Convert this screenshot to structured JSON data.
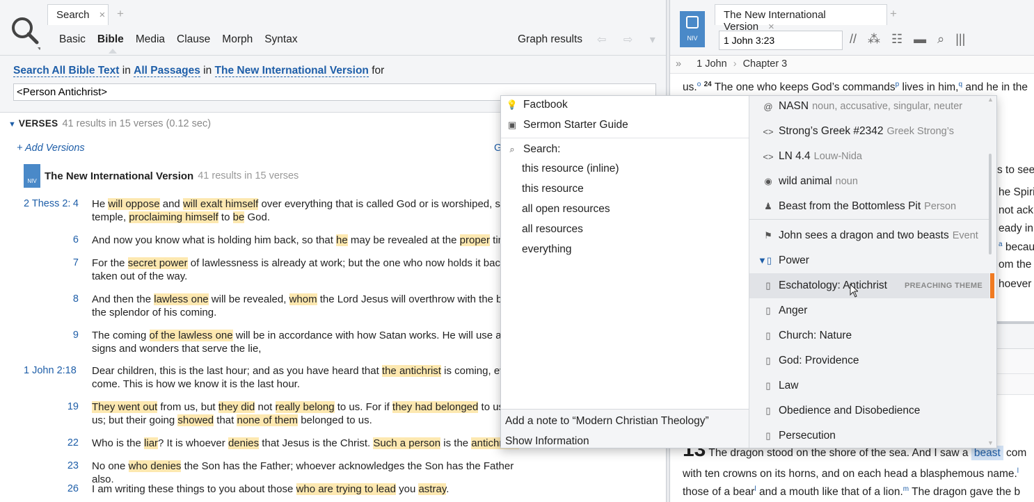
{
  "left_panel": {
    "tab_title": "Search",
    "tab_close": "×",
    "tab_add": "+",
    "search_kinds": [
      "Basic",
      "Bible",
      "Media",
      "Clause",
      "Morph",
      "Syntax"
    ],
    "active_kind": "Bible",
    "graph_results": "Graph results",
    "nav_arrows": "⇦ ⇨ ▾",
    "query": {
      "scope": "Search All Bible Text",
      "in1": "in",
      "passages": "All Passages",
      "in2": "in",
      "resource": "The New International Version",
      "for": "for",
      "input_value": "<Person Antichrist>"
    },
    "verses_header": {
      "label": "VERSES",
      "stats": "41 results in 15 verses (0.12 sec)"
    },
    "add_versions": "+ Add Versions",
    "g_fragment": "G",
    "resource_title": "The New International Version",
    "resource_count": "41 results in 15 verses",
    "niv_badge": "NIV"
  },
  "verses": [
    {
      "ref": "2 Thess 2:",
      "num": "4",
      "parts": [
        [
          "He ",
          false
        ],
        [
          "will oppose",
          true
        ],
        [
          " and ",
          false
        ],
        [
          "will exalt himself",
          true
        ],
        [
          " over everything that is called God or is worshiped, so t",
          false
        ]
      ],
      "parts2": [
        [
          "temple, ",
          false
        ],
        [
          "proclaiming himself",
          true
        ],
        [
          " to ",
          false
        ],
        [
          "be",
          true
        ],
        [
          " God.",
          false
        ]
      ]
    },
    {
      "ref": "",
      "num": "6",
      "parts": [
        [
          "And now you know what is holding him back, so that ",
          false
        ],
        [
          "he",
          true
        ],
        [
          " may be revealed at the ",
          false
        ],
        [
          "proper",
          true
        ],
        [
          " time",
          false
        ]
      ]
    },
    {
      "ref": "",
      "num": "7",
      "parts": [
        [
          "For the ",
          false
        ],
        [
          "secret power",
          true
        ],
        [
          " of lawlessness is already at work; but the one who now holds it back w",
          false
        ]
      ],
      "parts2": [
        [
          "taken out of the way.",
          false
        ]
      ]
    },
    {
      "ref": "",
      "num": "8",
      "parts": [
        [
          "And then the ",
          false
        ],
        [
          "lawless one",
          true
        ],
        [
          " will be revealed, ",
          false
        ],
        [
          "whom",
          true
        ],
        [
          " the Lord Jesus will overthrow with the bre",
          false
        ]
      ],
      "parts2": [
        [
          "the splendor of his coming.",
          false
        ]
      ]
    },
    {
      "ref": "",
      "num": "9",
      "parts": [
        [
          "The coming ",
          false
        ],
        [
          "of the lawless one",
          true
        ],
        [
          " will be in accordance with how Satan works. He will use all s",
          false
        ]
      ],
      "parts2": [
        [
          "signs and wonders that serve the lie,",
          false
        ]
      ]
    },
    {
      "ref": "1 John  2:18",
      "num": "",
      "parts": [
        [
          "Dear children, this is the last hour; and as you have heard that ",
          false
        ],
        [
          "the antichrist",
          true
        ],
        [
          " is coming, ever",
          false
        ]
      ],
      "parts2": [
        [
          "come. This is how we know it is the last hour.",
          false
        ]
      ]
    },
    {
      "ref": "",
      "num": "19",
      "parts": [
        [
          "They went out",
          true
        ],
        [
          " from us, but ",
          false
        ],
        [
          "they did",
          true
        ],
        [
          " not ",
          false
        ],
        [
          "really belong",
          true
        ],
        [
          " to us. For if ",
          false
        ],
        [
          "they had belonged",
          true
        ],
        [
          " to us, t",
          false
        ]
      ],
      "parts2": [
        [
          "us; but their going ",
          false
        ],
        [
          "showed",
          true
        ],
        [
          " that ",
          false
        ],
        [
          "none of them",
          true
        ],
        [
          " belonged to us.",
          false
        ]
      ]
    },
    {
      "ref": "",
      "num": "22",
      "parts": [
        [
          "Who is the ",
          false
        ],
        [
          "liar",
          true
        ],
        [
          "? It is whoever ",
          false
        ],
        [
          "denies",
          true
        ],
        [
          " that Jesus is the Christ. ",
          false
        ],
        [
          "Such a person",
          true
        ],
        [
          " is the ",
          false
        ],
        [
          "antichrist–",
          true
        ]
      ]
    },
    {
      "ref": "",
      "num": "23",
      "parts": [
        [
          "No one ",
          false
        ],
        [
          "who denies",
          true
        ],
        [
          " the Son has the Father; whoever acknowledges the Son has the Father also.",
          false
        ]
      ]
    },
    {
      "ref": "",
      "num": "26",
      "parts": [
        [
          "I am writing these things to you about those ",
          false
        ],
        [
          "who are trying to lead",
          true
        ],
        [
          " you ",
          false
        ],
        [
          "astray",
          true
        ],
        [
          ".",
          false
        ]
      ]
    }
  ],
  "right_panel": {
    "tab_title": "The New International Version",
    "tab_close": "×",
    "tab_add": "+",
    "logo_text": "NIV",
    "reference": "1 John 3:23",
    "tool_icons": [
      "//",
      "⁂",
      "☷",
      "▬",
      "⌕",
      "|||"
    ],
    "breadcrumb_toggle": "»",
    "breadcrumb_book": "1 John",
    "breadcrumb_sep": "›",
    "breadcrumb_chapter": "Chapter 3",
    "top_line": {
      "a": "us.",
      "sup_o": "o",
      "vnum": "24",
      "b": " The one who keeps God’s commands",
      "sup_p": "p",
      "c": " lives in him,",
      "sup_q": "q",
      "d": " and he in the"
    },
    "side_fragments": [
      "s to see w",
      "he Spiri",
      "not ackn",
      "eady in",
      "a",
      " becau",
      "om the w",
      "hoever i"
    ],
    "bottom": {
      "chap": "13",
      "line1a": " The dragon",
      "line1b": " stood on the shore of the sea. And I saw a ",
      "line1_word": "beast",
      "line1c": " com",
      "line2a": "with ten crowns on its horns, and on each head a blasphemous name.",
      "line2_sup": "l",
      "line3a": "those of a bear",
      "line3_sup1": "l",
      "line3b": " and a mouth like that of a lion.",
      "line3_sup2": "m",
      "line3c": " The dragon gave the b"
    }
  },
  "context_menu": {
    "left": {
      "factbook": "Factbook",
      "sermon": "Sermon Starter Guide",
      "search_label": "Search:",
      "search_options": [
        "this resource (inline)",
        "this resource",
        "all open resources",
        "all resources",
        "everything"
      ],
      "add_note": "Add a note to “Modern Christian Theology”",
      "show_info": "Show Information"
    },
    "right": [
      {
        "icon": "@",
        "label": "NASN",
        "muted": "noun, accusative, singular, neuter"
      },
      {
        "icon": "<>",
        "label": "Strong’s Greek #2342",
        "muted": "Greek Strong’s"
      },
      {
        "icon": "<>",
        "label": "LN 4.4",
        "muted": "Louw-Nida"
      },
      {
        "icon": "◉",
        "label": "wild animal",
        "muted": "noun"
      },
      {
        "icon": "♟",
        "label": "Beast from the Bottomless Pit",
        "muted": "Person"
      },
      {
        "icon": "⚑",
        "label": "John sees a dragon and two beasts",
        "muted": "Event"
      },
      {
        "icon": "▼▯",
        "label": "Power",
        "muted": ""
      },
      {
        "icon": "▯",
        "label": "Eschatology: Antichrist",
        "muted": "",
        "tag": "PREACHING THEME"
      },
      {
        "icon": "▯",
        "label": "Anger",
        "muted": ""
      },
      {
        "icon": "▯",
        "label": "Church: Nature",
        "muted": ""
      },
      {
        "icon": "▯",
        "label": "God: Providence",
        "muted": ""
      },
      {
        "icon": "▯",
        "label": "Law",
        "muted": ""
      },
      {
        "icon": "▯",
        "label": "Obedience and Disobedience",
        "muted": ""
      },
      {
        "icon": "▯",
        "label": "Persecution",
        "muted": ""
      }
    ]
  },
  "colors": {
    "link": "#1e5ea8",
    "highlight": "#fde8b0",
    "niv_blue": "#4a89c8",
    "theme_accent": "#f07b22"
  }
}
